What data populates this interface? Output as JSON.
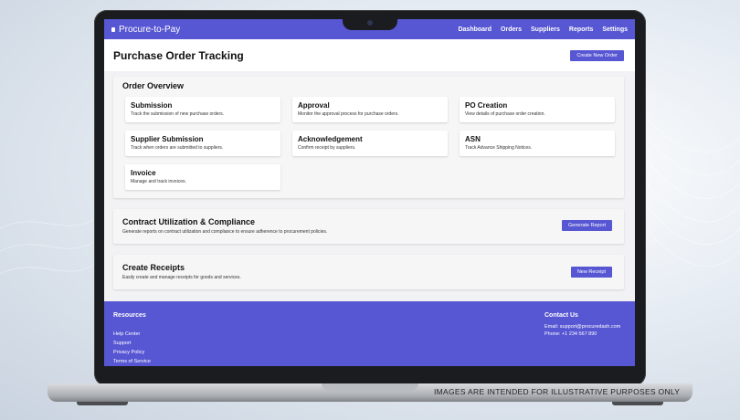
{
  "app": {
    "brand": "Procure-to-Pay",
    "nav": [
      "Dashboard",
      "Orders",
      "Suppliers",
      "Reports",
      "Settings"
    ]
  },
  "header": {
    "title": "Purchase Order Tracking",
    "create_button": "Create New Order"
  },
  "overview": {
    "title": "Order Overview",
    "tiles": [
      {
        "title": "Submission",
        "desc": "Track the submission of new purchase orders."
      },
      {
        "title": "Approval",
        "desc": "Monitor the approval process for purchase orders."
      },
      {
        "title": "PO Creation",
        "desc": "View details of purchase order creation."
      },
      {
        "title": "Supplier Submission",
        "desc": "Track when orders are submitted to suppliers."
      },
      {
        "title": "Acknowledgement",
        "desc": "Confirm receipt by suppliers."
      },
      {
        "title": "ASN",
        "desc": "Track Advance Shipping Notices."
      },
      {
        "title": "Invoice",
        "desc": "Manage and track invoices."
      }
    ]
  },
  "contract": {
    "title": "Contract Utilization & Compliance",
    "desc": "Generate reports on contract utilization and compliance to ensure adherence to procurement policies.",
    "button": "Generate Report"
  },
  "receipts": {
    "title": "Create Receipts",
    "desc": "Easily create and manage receipts for goods and services.",
    "button": "New Receipt"
  },
  "footer": {
    "resources_title": "Resources",
    "links": [
      "Help Center",
      "Support",
      "Privacy Policy",
      "Terms of Service"
    ],
    "contact_title": "Contact Us",
    "email": "Email: support@procuredash.com",
    "phone": "Phone: +1 234 567 890"
  },
  "disclaimer": "IMAGES ARE INTENDED FOR ILLUSTRATIVE PURPOSES ONLY",
  "colors": {
    "accent": "#5756d3"
  }
}
